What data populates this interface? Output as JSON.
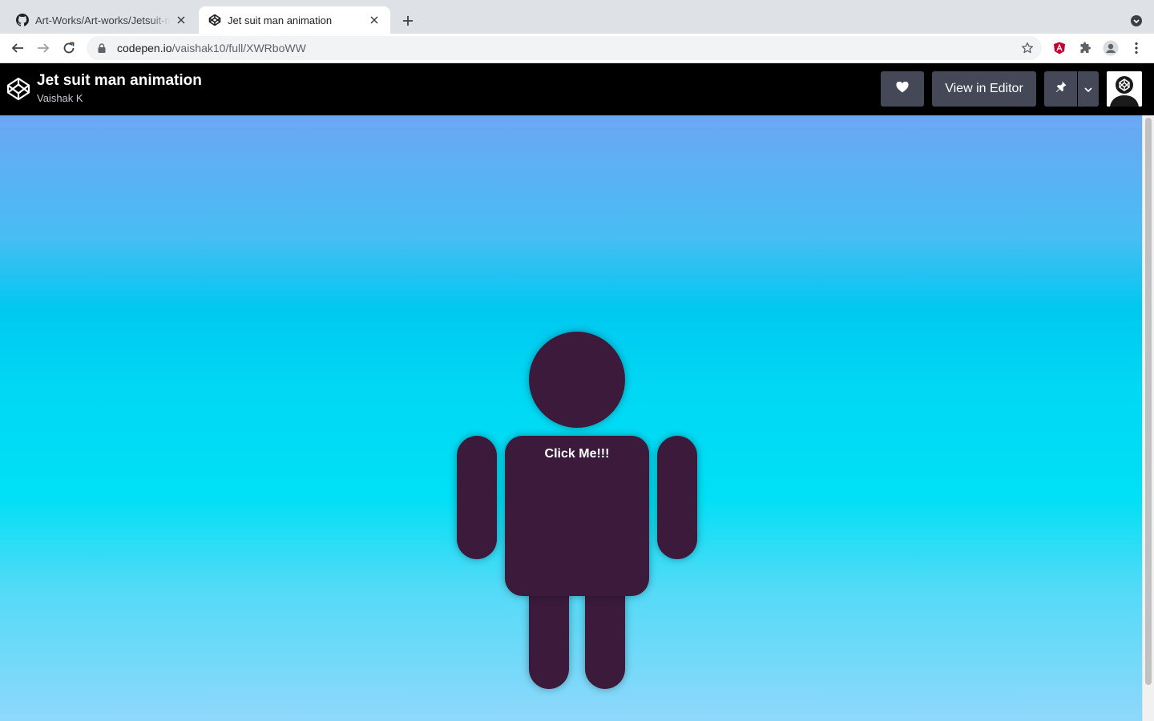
{
  "browser": {
    "tabs": [
      {
        "title": "Art-Works/Art-works/Jetsuit-man",
        "icon": "github-icon",
        "active": false
      },
      {
        "title": "Jet suit man animation",
        "icon": "codepen-icon",
        "active": true
      }
    ],
    "url": {
      "host": "codepen.io",
      "path": "/vaishak10/full/XWRboWW"
    }
  },
  "codepen": {
    "title": "Jet suit man animation",
    "author": "Vaishak K",
    "view_editor_label": "View in Editor"
  },
  "stage": {
    "button_label": "Click Me!!!",
    "figure_color": "#3b1a3c"
  },
  "colors": {
    "header_bg": "#000000",
    "button_bg": "#444857",
    "gradient_top": "#6ba6f4",
    "gradient_mid": "#00e0f6",
    "gradient_bottom": "#8fd8fb"
  }
}
